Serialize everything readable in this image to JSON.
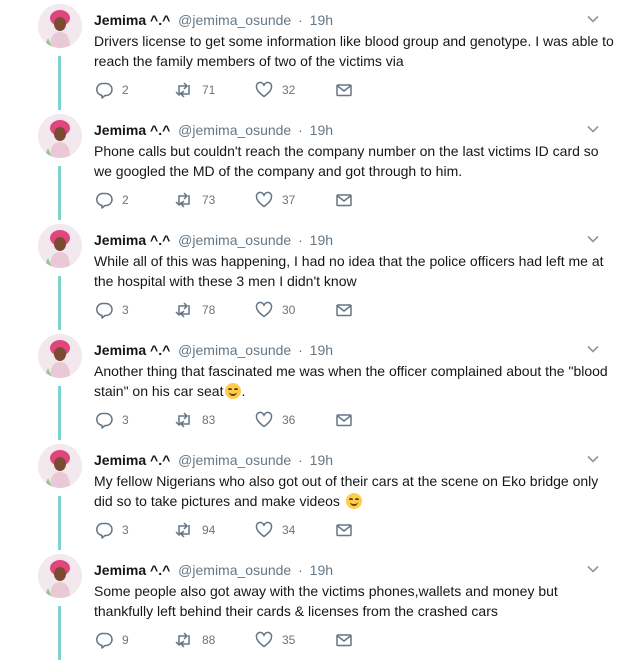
{
  "tweets": [
    {
      "author": "Jemima ^.^",
      "handle": "@jemima_osunde",
      "separator": "·",
      "time": "19h",
      "text": "Drivers license to get some information like blood group and genotype. I was able to reach the family members of two of the victims via",
      "replies": "2",
      "retweets": "71",
      "likes": "32"
    },
    {
      "author": "Jemima ^.^",
      "handle": "@jemima_osunde",
      "separator": "·",
      "time": "19h",
      "text": "Phone calls but couldn't reach the company number on the last victims ID card so we googled the MD of the company and got through to him.",
      "replies": "2",
      "retweets": "73",
      "likes": "37"
    },
    {
      "author": "Jemima ^.^",
      "handle": "@jemima_osunde",
      "separator": "·",
      "time": "19h",
      "text": "While all of this was happening, I had no idea that the police officers had left me at the hospital with these 3 men I didn't know",
      "replies": "3",
      "retweets": "78",
      "likes": "30"
    },
    {
      "author": "Jemima ^.^",
      "handle": "@jemima_osunde",
      "separator": "·",
      "time": "19h",
      "text": "Another thing that fascinated me was when the officer complained about the \"blood stain\" on his car seat",
      "text_after_emoji": ".",
      "replies": "3",
      "retweets": "83",
      "likes": "36"
    },
    {
      "author": "Jemima ^.^",
      "handle": "@jemima_osunde",
      "separator": "·",
      "time": "19h",
      "text": "My fellow Nigerians who also got out of their cars at the scene on Eko bridge only did so to take pictures and make videos ",
      "text_after_emoji": "",
      "replies": "3",
      "retweets": "94",
      "likes": "34"
    },
    {
      "author": "Jemima ^.^",
      "handle": "@jemima_osunde",
      "separator": "·",
      "time": "19h",
      "text": "Some people also got away with the victims phones,wallets and money but thankfully left behind their cards & licenses from the crashed cars",
      "replies": "9",
      "retweets": "88",
      "likes": "35"
    }
  ],
  "icons": {
    "reply": "reply-icon",
    "retweet": "retweet-icon",
    "like": "heart-icon",
    "dm": "envelope-icon",
    "caret": "chevron-down-icon",
    "emoji": "smiling-face-emoji"
  },
  "colors": {
    "thread_line": "#7ed3cf",
    "secondary_text": "#657786",
    "primary_text": "#14171a"
  }
}
